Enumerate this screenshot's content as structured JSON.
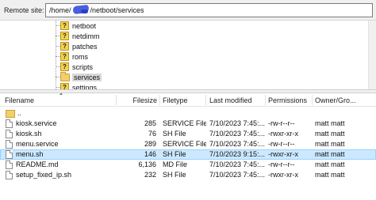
{
  "site": {
    "label": "Remote site:",
    "path_prefix": "/home/",
    "path_suffix": "/netboot/services"
  },
  "tree": {
    "items": [
      {
        "label": "netboot",
        "icon": "question-icon"
      },
      {
        "label": "netdimm",
        "icon": "question-icon"
      },
      {
        "label": "patches",
        "icon": "question-icon"
      },
      {
        "label": "roms",
        "icon": "question-icon"
      },
      {
        "label": "scripts",
        "icon": "question-icon"
      },
      {
        "label": "services",
        "icon": "folder-icon"
      },
      {
        "label": "settings",
        "icon": "question-icon"
      }
    ],
    "selected": "services"
  },
  "columns": {
    "filename": "Filename",
    "filesize": "Filesize",
    "filetype": "Filetype",
    "modified": "Last modified",
    "permissions": "Permissions",
    "owner": "Owner/Gro..."
  },
  "files": [
    {
      "name": "..",
      "size": "",
      "type": "",
      "modified": "",
      "perms": "",
      "owner": "",
      "icon": "parent-folder-icon"
    },
    {
      "name": "kiosk.service",
      "size": "285",
      "type": "SERVICE File",
      "modified": "7/10/2023 7:45:...",
      "perms": "-rw-r--r--",
      "owner": "matt matt",
      "icon": "file-icon"
    },
    {
      "name": "kiosk.sh",
      "size": "76",
      "type": "SH File",
      "modified": "7/10/2023 7:45:...",
      "perms": "-rwxr-xr-x",
      "owner": "matt matt",
      "icon": "file-icon"
    },
    {
      "name": "menu.service",
      "size": "289",
      "type": "SERVICE File",
      "modified": "7/10/2023 7:45:...",
      "perms": "-rw-r--r--",
      "owner": "matt matt",
      "icon": "file-icon"
    },
    {
      "name": "menu.sh",
      "size": "146",
      "type": "SH File",
      "modified": "7/10/2023 9:15:...",
      "perms": "-rwxr-xr-x",
      "owner": "matt matt",
      "icon": "file-icon"
    },
    {
      "name": "README.md",
      "size": "6,136",
      "type": "MD File",
      "modified": "7/10/2023 7:45:...",
      "perms": "-rw-r--r--",
      "owner": "matt matt",
      "icon": "file-icon"
    },
    {
      "name": "setup_fixed_ip.sh",
      "size": "232",
      "type": "SH File",
      "modified": "7/10/2023 7:45:...",
      "perms": "-rwxr-xr-x",
      "owner": "matt matt",
      "icon": "file-icon"
    }
  ],
  "selected_file": "menu.sh"
}
